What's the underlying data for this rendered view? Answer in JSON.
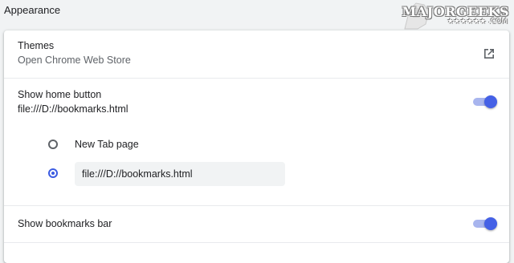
{
  "section": {
    "title": "Appearance"
  },
  "watermark": {
    "brand": "MAJORGEEKS",
    "sub": "★★★★★★ .COM"
  },
  "themes": {
    "label": "Themes",
    "sublabel": "Open Chrome Web Store",
    "icon": "open-in-new-icon"
  },
  "home_button": {
    "label": "Show home button",
    "sublabel": "file:///D://bookmarks.html",
    "enabled": true,
    "options": [
      {
        "label": "New Tab page",
        "checked": false
      },
      {
        "value": "file:///D://bookmarks.html",
        "checked": true
      }
    ]
  },
  "bookmarks_bar": {
    "label": "Show bookmarks bar",
    "enabled": true
  },
  "colors": {
    "accent": "#4561e6",
    "accent_track": "#a8b5ee",
    "card": "#ffffff",
    "background": "#f1f3f4"
  }
}
